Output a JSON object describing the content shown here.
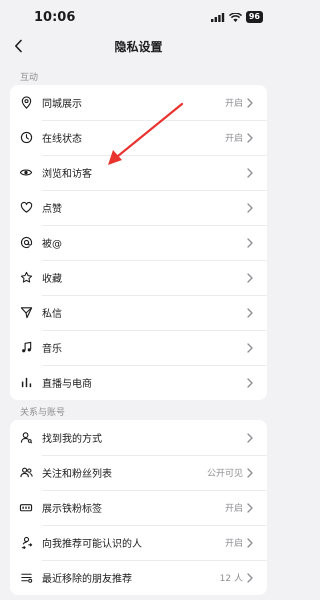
{
  "status": {
    "time": "10:06",
    "battery": "96"
  },
  "header": {
    "title": "隐私设置"
  },
  "sections": [
    {
      "title": "互动",
      "items": [
        {
          "label": "同城展示",
          "value": "开启",
          "icon": "location-pin-icon"
        },
        {
          "label": "在线状态",
          "value": "开启",
          "icon": "clock-icon"
        },
        {
          "label": "浏览和访客",
          "value": "",
          "icon": "eye-icon"
        },
        {
          "label": "点赞",
          "value": "",
          "icon": "heart-icon"
        },
        {
          "label": "被@",
          "value": "",
          "icon": "at-icon"
        },
        {
          "label": "收藏",
          "value": "",
          "icon": "star-icon"
        },
        {
          "label": "私信",
          "value": "",
          "icon": "send-icon"
        },
        {
          "label": "音乐",
          "value": "",
          "icon": "music-note-icon"
        },
        {
          "label": "直播与电商",
          "value": "",
          "icon": "bar-chart-icon"
        }
      ]
    },
    {
      "title": "关系与账号",
      "items": [
        {
          "label": "找到我的方式",
          "value": "",
          "icon": "person-search-icon"
        },
        {
          "label": "关注和粉丝列表",
          "value": "公开可见",
          "icon": "people-icon"
        },
        {
          "label": "展示铁粉标签",
          "value": "开启",
          "icon": "badge-icon"
        },
        {
          "label": "向我推荐可能认识的人",
          "value": "开启",
          "icon": "person-share-icon"
        },
        {
          "label": "最近移除的朋友推荐",
          "value": "12 人",
          "icon": "list-icon"
        }
      ]
    }
  ]
}
